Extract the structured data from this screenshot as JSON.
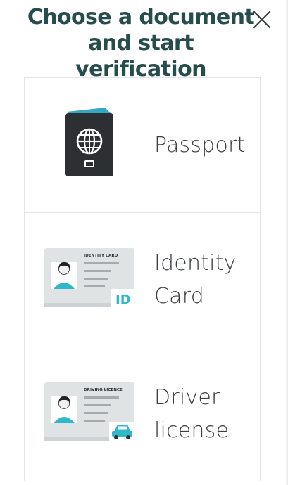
{
  "header": {
    "title": "Choose a document and start verification",
    "close_icon": "close-icon"
  },
  "documents": [
    {
      "label": "Passport",
      "icon": "passport-icon"
    },
    {
      "label": "Identity Card",
      "icon": "identity-card-icon",
      "card_header": "IDENTITY CARD",
      "badge": "ID"
    },
    {
      "label": "Driver license",
      "icon": "driver-licence-icon",
      "card_header": "DRIVING LICENCE",
      "badge_icon": "car-icon"
    }
  ],
  "colors": {
    "title": "#274c4c",
    "label": "#3b3f42",
    "border": "#e3e6e7",
    "accent": "#2fb9c8",
    "passport": "#2d3033",
    "passport_top": "#36a6c5"
  }
}
